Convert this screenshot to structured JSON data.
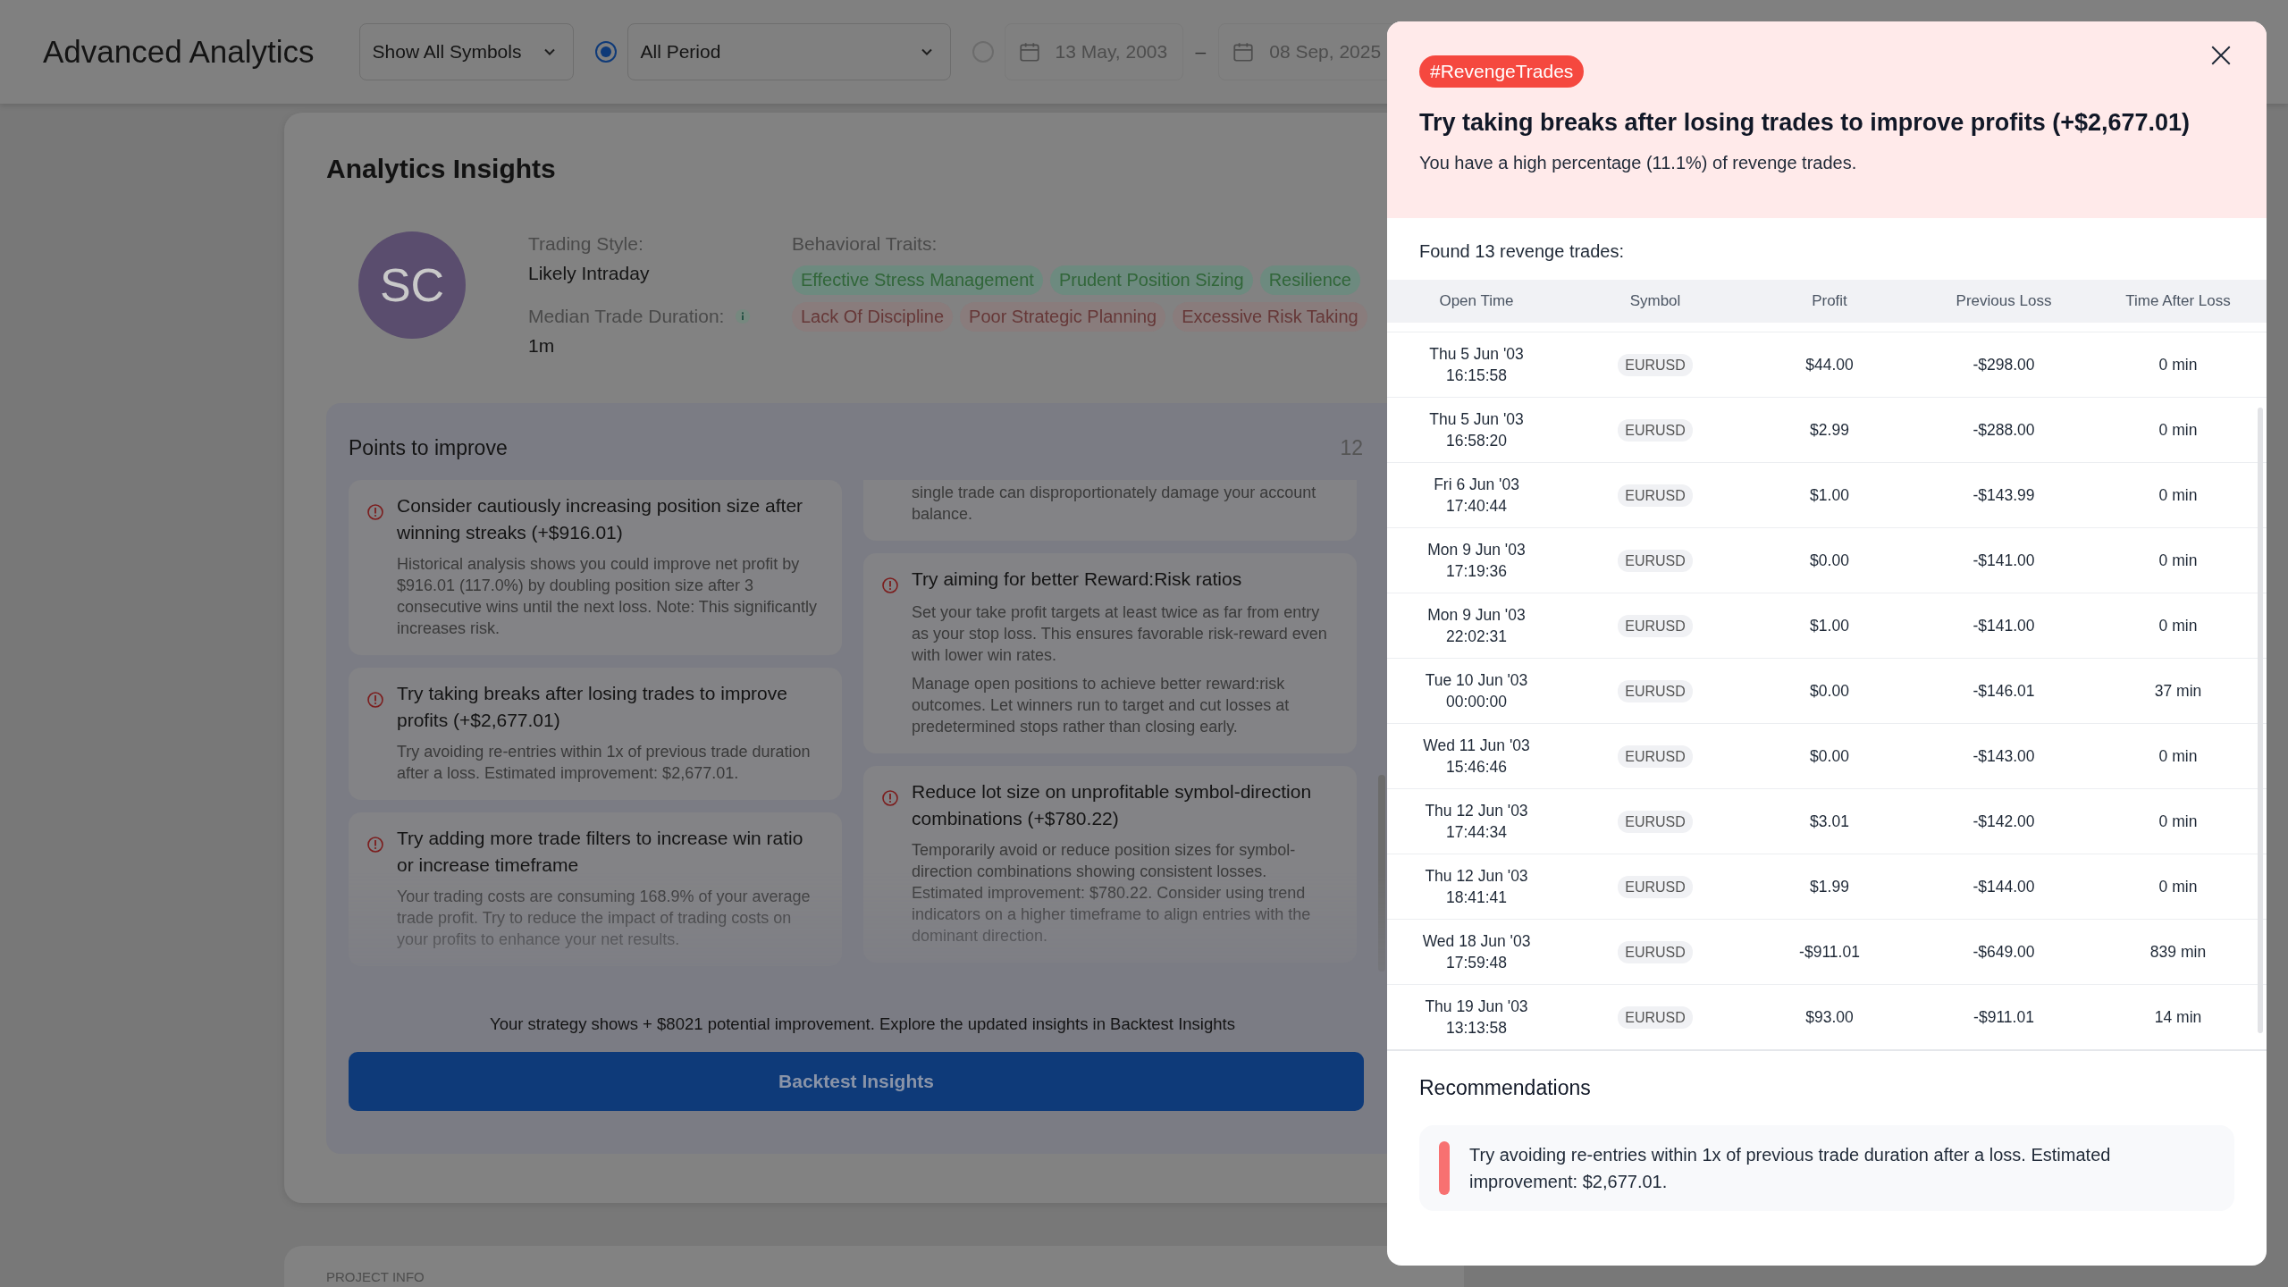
{
  "header": {
    "title": "Advanced Analytics",
    "symbols": {
      "value": "Show All Symbols"
    },
    "period_options": [
      {
        "kind": "select",
        "value": "All Period",
        "selected": true
      },
      {
        "kind": "range",
        "from": "13 May, 2003",
        "separator": "–",
        "to": "08 Sep, 2025",
        "selected": false
      }
    ]
  },
  "insights": {
    "title": "Analytics Insights",
    "avatar": "SC",
    "trading_style": {
      "label": "Trading Style:",
      "value": "Likely Intraday"
    },
    "median_duration": {
      "label": "Median Trade Duration:",
      "value": "1m"
    },
    "traits_label": "Behavioral Traits:",
    "traits": [
      {
        "label": "Effective Stress Management",
        "color": "#6d8a7f"
      },
      {
        "label": "Prudent Position Sizing",
        "color": "#6d8a7f"
      },
      {
        "label": "Resilience",
        "color": "#6d8a7f"
      },
      {
        "label": "Lack Of Discipline",
        "color": "#897c7c"
      },
      {
        "label": "Poor Strategic Planning",
        "color": "#897c7c"
      },
      {
        "label": "Excessive Risk Taking",
        "color": "#897c7c"
      }
    ],
    "points": {
      "title": "Points to improve",
      "count": "12",
      "left": [
        {
          "title": "Consider cautiously increasing position size after winning streaks (+$916.01)",
          "paragraphs": [
            "Historical analysis shows you could improve net profit by $916.01 (117.0%) by doubling position size after 3 consecutive wins until the next loss. Note: This significantly increases risk."
          ]
        },
        {
          "title": "Try taking breaks after losing trades to improve profits (+$2,677.01)",
          "paragraphs": [
            "Try avoiding re-entries within 1x of previous trade duration after a loss. Estimated improvement: $2,677.01."
          ]
        },
        {
          "title": "Try adding more trade filters to increase win ratio or increase timeframe",
          "paragraphs": [
            "Your trading costs are consuming 168.9% of your average trade profit. Try to reduce the impact of trading costs on your profits to enhance your net results."
          ]
        }
      ],
      "right": [
        {
          "paragraphs": [
            "single trade can disproportionately damage your account balance."
          ]
        },
        {
          "title": "Try aiming for better Reward:Risk ratios",
          "paragraphs": [
            "Set your take profit targets at least twice as far from entry as your stop loss. This ensures favorable risk-reward even with lower win rates.",
            "Manage open positions to achieve better reward:risk outcomes. Let winners run to target and cut losses at predetermined stops rather than closing early."
          ]
        },
        {
          "title": "Reduce lot size on unprofitable symbol-direction combinations (+$780.22)",
          "paragraphs": [
            "Temporarily avoid or reduce position sizes for symbol-direction combinations showing consistent losses. Estimated improvement: $780.22. Consider using trend indicators on a higher timeframe to align entries with the dominant direction."
          ]
        }
      ],
      "summary": "Your strategy shows + $8021 potential improvement. Explore the updated insights in Backtest Insights",
      "button": "Backtest Insights"
    }
  },
  "project_info": {
    "label": "PROJECT INFO"
  },
  "modal": {
    "tag": "#RevengeTrades",
    "title": "Try taking breaks after losing trades to improve profits (+$2,677.01)",
    "subtitle": "You have a high percentage (11.1%) of revenge trades.",
    "found": "Found 13 revenge trades:",
    "columns": [
      "Open Time",
      "Symbol",
      "Profit",
      "Previous Loss",
      "Time After Loss"
    ],
    "rows": [
      {
        "open_time": "Thu 5 Jun '03\n16:15:58",
        "symbol": "EURUSD",
        "profit": "$44.00",
        "previous_loss": "-$298.00",
        "time_after_loss": "0 min"
      },
      {
        "open_time": "Thu 5 Jun '03\n16:58:20",
        "symbol": "EURUSD",
        "profit": "$2.99",
        "previous_loss": "-$288.00",
        "time_after_loss": "0 min"
      },
      {
        "open_time": "Fri 6 Jun '03\n17:40:44",
        "symbol": "EURUSD",
        "profit": "$1.00",
        "previous_loss": "-$143.99",
        "time_after_loss": "0 min"
      },
      {
        "open_time": "Mon 9 Jun '03\n17:19:36",
        "symbol": "EURUSD",
        "profit": "$0.00",
        "previous_loss": "-$141.00",
        "time_after_loss": "0 min"
      },
      {
        "open_time": "Mon 9 Jun '03\n22:02:31",
        "symbol": "EURUSD",
        "profit": "$1.00",
        "previous_loss": "-$141.00",
        "time_after_loss": "0 min"
      },
      {
        "open_time": "Tue 10 Jun '03\n00:00:00",
        "symbol": "EURUSD",
        "profit": "$0.00",
        "previous_loss": "-$146.01",
        "time_after_loss": "37 min"
      },
      {
        "open_time": "Wed 11 Jun '03\n15:46:46",
        "symbol": "EURUSD",
        "profit": "$0.00",
        "previous_loss": "-$143.00",
        "time_after_loss": "0 min"
      },
      {
        "open_time": "Thu 12 Jun '03\n17:44:34",
        "symbol": "EURUSD",
        "profit": "$3.01",
        "previous_loss": "-$142.00",
        "time_after_loss": "0 min"
      },
      {
        "open_time": "Thu 12 Jun '03\n18:41:41",
        "symbol": "EURUSD",
        "profit": "$1.99",
        "previous_loss": "-$144.00",
        "time_after_loss": "0 min"
      },
      {
        "open_time": "Wed 18 Jun '03\n17:59:48",
        "symbol": "EURUSD",
        "profit": "-$911.01",
        "previous_loss": "-$649.00",
        "time_after_loss": "839 min"
      },
      {
        "open_time": "Thu 19 Jun '03\n13:13:58",
        "symbol": "EURUSD",
        "profit": "$93.00",
        "previous_loss": "-$911.01",
        "time_after_loss": "14 min"
      }
    ],
    "recommendations": {
      "title": "Recommendations",
      "items": [
        "Try avoiding re-entries within 1x of previous trade duration after a loss. Estimated improvement: $2,677.01."
      ]
    }
  }
}
